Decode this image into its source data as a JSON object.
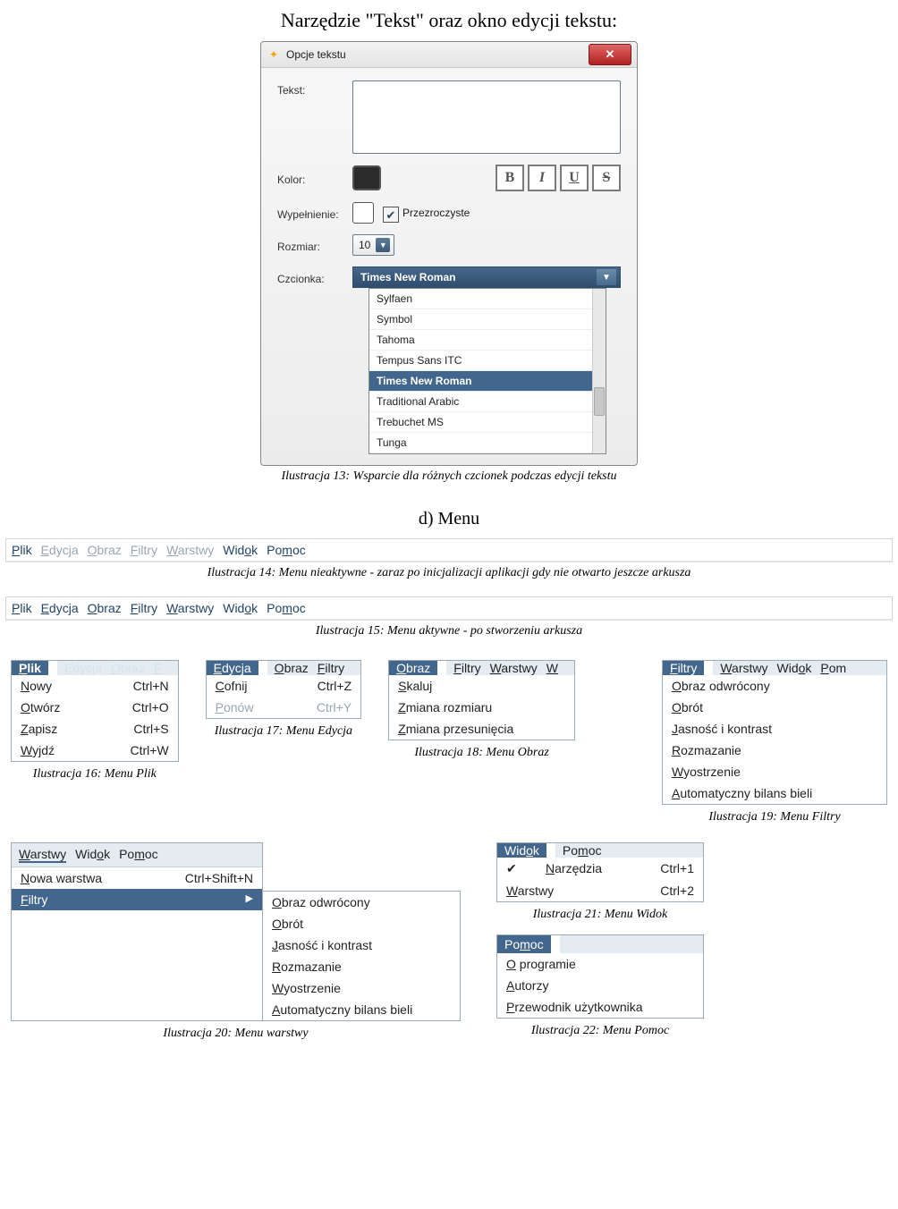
{
  "doc": {
    "title_top": "Narzędzie \"Tekst\" oraz okno edycji tekstu:",
    "caption13": "Ilustracja 13: Wsparcie dla różnych czcionek podczas edycji tekstu",
    "section_d": "d) Menu",
    "caption14": "Ilustracja 14: Menu nieaktywne - zaraz po inicjalizacji aplikacji gdy nie otwarto jeszcze arkusza",
    "caption15": "Ilustracja 15: Menu aktywne - po stworzeniu arkusza",
    "caption16": "Ilustracja 16: Menu Plik",
    "caption17": "Ilustracja 17: Menu Edycja",
    "caption18": "Ilustracja 18: Menu Obraz",
    "caption19": "Ilustracja 19: Menu Filtry",
    "caption20": "Ilustracja 20: Menu warstwy",
    "caption21": "Ilustracja 21: Menu Widok",
    "caption22": "Ilustracja 22: Menu Pomoc"
  },
  "dialog": {
    "title": "Opcje tekstu",
    "labels": {
      "text": "Tekst:",
      "color": "Kolor:",
      "fill": "Wypełnienie:",
      "transparent": "Przezroczyste",
      "size": "Rozmiar:",
      "font": "Czcionka:"
    },
    "size_value": "10",
    "font_value": "Times New Roman",
    "font_options": [
      "Sylfaen",
      "Symbol",
      "Tahoma",
      "Tempus Sans ITC",
      "Times New Roman",
      "Traditional Arabic",
      "Trebuchet MS",
      "Tunga"
    ],
    "font_selected_index": 4
  },
  "menubar_items": [
    "Plik",
    "Edycja",
    "Obraz",
    "Filtry",
    "Warstwy",
    "Widok",
    "Pomoc"
  ],
  "menu_plik": {
    "header": [
      "Plik",
      "Edycja",
      "Obraz",
      "F"
    ],
    "items": [
      {
        "lbl": "Nowy",
        "accel": "Ctrl+N"
      },
      {
        "lbl": "Otwórz",
        "accel": "Ctrl+O"
      },
      {
        "lbl": "Zapisz",
        "accel": "Ctrl+S"
      },
      {
        "lbl": "Wyjdź",
        "accel": "Ctrl+W"
      }
    ]
  },
  "menu_edycja": {
    "header": [
      "Edycja",
      "Obraz",
      "Filtry"
    ],
    "items": [
      {
        "lbl": "Cofnij",
        "accel": "Ctrl+Z"
      },
      {
        "lbl": "Ponów",
        "accel": "Ctrl+Y",
        "dim": true
      }
    ]
  },
  "menu_obraz": {
    "header": [
      "Obraz",
      "Filtry",
      "Warstwy",
      "W"
    ],
    "items": [
      {
        "lbl": "Skaluj"
      },
      {
        "lbl": "Zmiana rozmiaru"
      },
      {
        "lbl": "Zmiana przesunięcia"
      }
    ]
  },
  "menu_filtry": {
    "header": [
      "Filtry",
      "Warstwy",
      "Widok",
      "Pom"
    ],
    "items": [
      {
        "lbl": "Obraz odwrócony"
      },
      {
        "lbl": "Obrót"
      },
      {
        "lbl": "Jasność i kontrast"
      },
      {
        "lbl": "Rozmazanie"
      },
      {
        "lbl": "Wyostrzenie"
      },
      {
        "lbl": "Automatyczny bilans bieli"
      }
    ]
  },
  "menu_warstwy": {
    "header": [
      "Warstwy",
      "Widok",
      "Pomoc"
    ],
    "items": [
      {
        "lbl": "Nowa warstwa",
        "accel": "Ctrl+Shift+N"
      },
      {
        "lbl": "Filtry",
        "sub": true,
        "active": true
      }
    ],
    "sub": [
      {
        "lbl": "Obraz odwrócony"
      },
      {
        "lbl": "Obrót"
      },
      {
        "lbl": "Jasność i kontrast"
      },
      {
        "lbl": "Rozmazanie"
      },
      {
        "lbl": "Wyostrzenie"
      },
      {
        "lbl": "Automatyczny bilans bieli"
      }
    ]
  },
  "menu_widok": {
    "header": [
      "Widok",
      "Pomoc"
    ],
    "items": [
      {
        "lbl": "Narzędzia",
        "accel": "Ctrl+1",
        "check": true
      },
      {
        "lbl": "Warstwy",
        "accel": "Ctrl+2"
      }
    ]
  },
  "menu_pomoc": {
    "header": [
      "Pomoc"
    ],
    "items": [
      {
        "lbl": "O programie"
      },
      {
        "lbl": "Autorzy"
      },
      {
        "lbl": "Przewodnik użytkownika"
      }
    ]
  }
}
